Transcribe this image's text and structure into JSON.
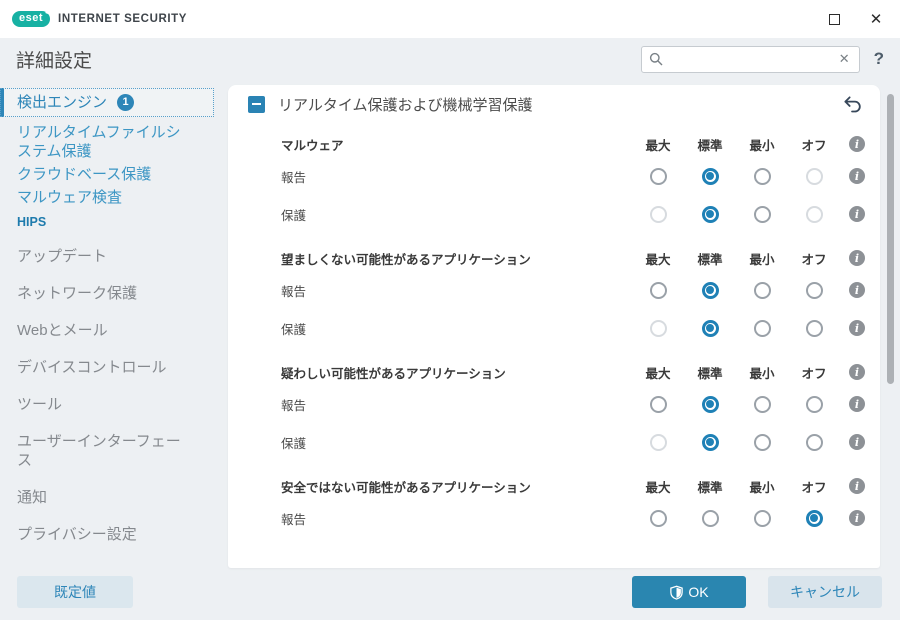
{
  "window": {
    "brand": "eset",
    "product": "INTERNET SECURITY",
    "close_glyph": "✕"
  },
  "header": {
    "title": "詳細設定",
    "search_value": "",
    "clear_glyph": "✕",
    "help_glyph": "?"
  },
  "sidebar": {
    "items": [
      {
        "label": "検出エンジン",
        "badge": "1",
        "state": "selected"
      },
      {
        "label": "リアルタイムファイルシステム保護",
        "state": "sub"
      },
      {
        "label": "クラウドベース保護",
        "state": "sub"
      },
      {
        "label": "マルウェア検査",
        "state": "sub"
      },
      {
        "label": "HIPS",
        "state": "sub-latin"
      },
      {
        "label": "アップデート",
        "state": "normal"
      },
      {
        "label": "ネットワーク保護",
        "state": "normal"
      },
      {
        "label": "Webとメール",
        "state": "normal"
      },
      {
        "label": "デバイスコントロール",
        "state": "normal"
      },
      {
        "label": "ツール",
        "state": "normal"
      },
      {
        "label": "ユーザーインターフェース",
        "state": "normal"
      },
      {
        "label": "通知",
        "state": "normal"
      },
      {
        "label": "プライバシー設定",
        "state": "normal"
      }
    ]
  },
  "panel": {
    "section_title": "リアルタイム保護および機械学習保護",
    "columns": [
      "最大",
      "標準",
      "最小",
      "オフ"
    ],
    "groups": [
      {
        "label": "マルウェア",
        "rows": [
          {
            "label": "報告",
            "cells": [
              "normal",
              "selected",
              "normal",
              "disabled"
            ]
          },
          {
            "label": "保護",
            "cells": [
              "disabled",
              "selected",
              "normal",
              "disabled"
            ]
          }
        ]
      },
      {
        "label": "望ましくない可能性があるアプリケーション",
        "rows": [
          {
            "label": "報告",
            "cells": [
              "normal",
              "selected",
              "normal",
              "normal"
            ]
          },
          {
            "label": "保護",
            "cells": [
              "disabled",
              "selected",
              "normal",
              "normal"
            ]
          }
        ]
      },
      {
        "label": "疑わしい可能性があるアプリケーション",
        "rows": [
          {
            "label": "報告",
            "cells": [
              "normal",
              "selected",
              "normal",
              "normal"
            ]
          },
          {
            "label": "保護",
            "cells": [
              "disabled",
              "selected",
              "normal",
              "normal"
            ]
          }
        ]
      },
      {
        "label": "安全ではない可能性があるアプリケーション",
        "rows": [
          {
            "label": "報告",
            "cells": [
              "normal",
              "normal",
              "normal",
              "selected"
            ]
          }
        ]
      }
    ]
  },
  "icons": {
    "info": "i"
  },
  "footer": {
    "default_label": "既定値",
    "ok_label": "OK",
    "cancel_label": "キャンセル"
  },
  "colors": {
    "accent_blue": "#2e86b8",
    "radio_blue": "#1f81b6",
    "brand_teal": "#17b1a3",
    "ok_button": "#2a86b0",
    "light_button": "#dbe7ee",
    "background": "#edf0f3"
  }
}
